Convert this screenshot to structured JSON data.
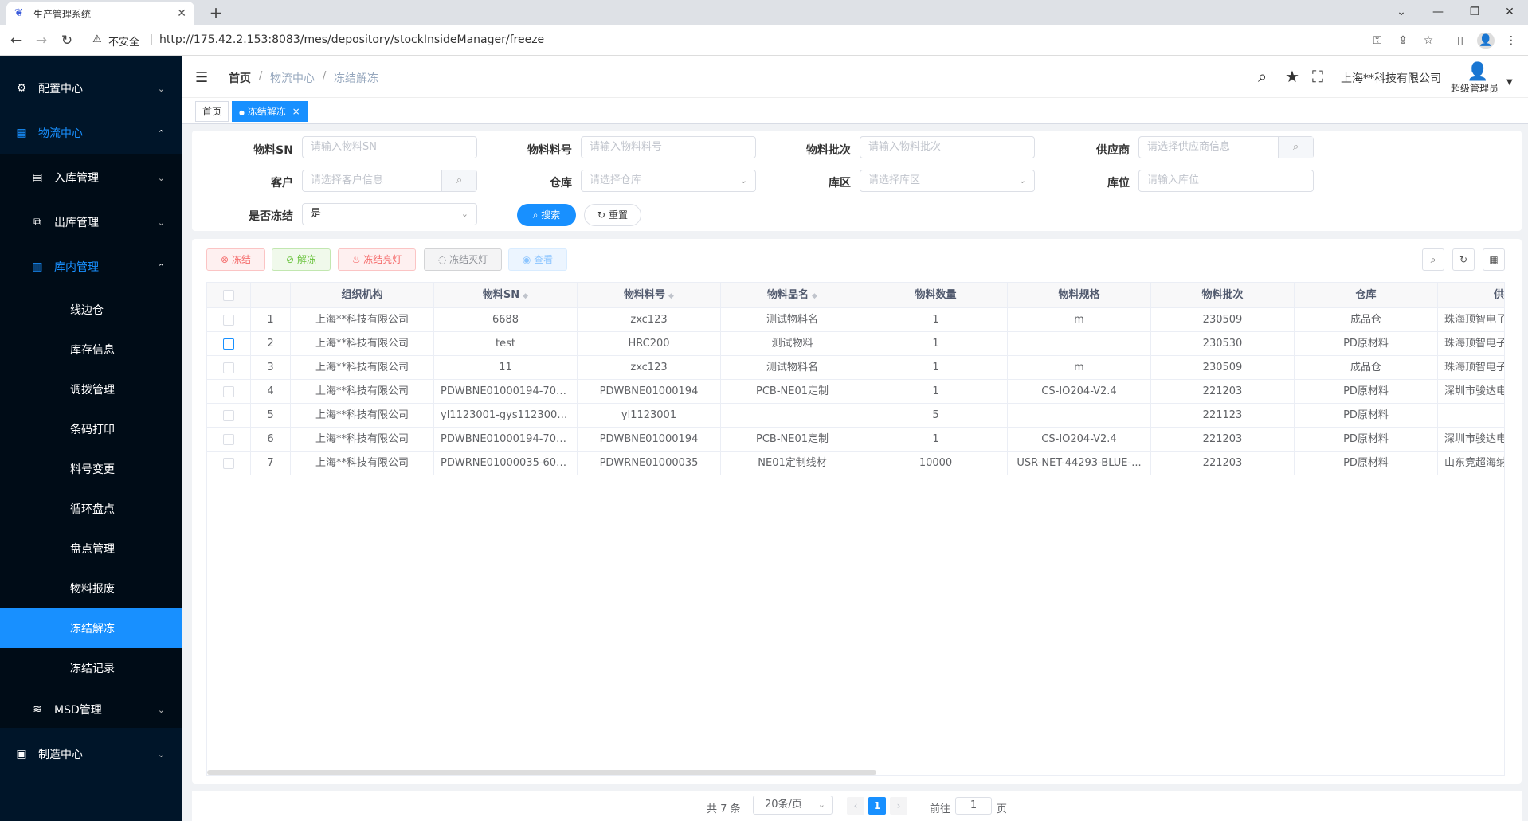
{
  "browser": {
    "tab_title": "生产管理系统",
    "security_label": "不安全",
    "url": "http://175.42.2.153:8083/mes/depository/stockInsideManager/freeze"
  },
  "sidebar": {
    "items": [
      {
        "label": "配置中心",
        "icon": "gear-icon"
      },
      {
        "label": "物流中心",
        "icon": "grid-icon"
      },
      {
        "label": "入库管理",
        "icon": "inbox-icon"
      },
      {
        "label": "出库管理",
        "icon": "export-icon"
      },
      {
        "label": "库内管理",
        "icon": "warehouse-icon"
      },
      {
        "label": "线边仓"
      },
      {
        "label": "库存信息"
      },
      {
        "label": "调拨管理"
      },
      {
        "label": "条码打印"
      },
      {
        "label": "料号变更"
      },
      {
        "label": "循环盘点"
      },
      {
        "label": "盘点管理"
      },
      {
        "label": "物料报废"
      },
      {
        "label": "冻结解冻"
      },
      {
        "label": "冻结记录"
      },
      {
        "label": "MSD管理",
        "icon": "layers-icon"
      },
      {
        "label": "制造中心",
        "icon": "factory-icon"
      }
    ]
  },
  "header": {
    "breadcrumb": [
      "首页",
      "物流中心",
      "冻结解冻"
    ],
    "company": "上海**科技有限公司",
    "user": "超级管理员"
  },
  "tags": {
    "home": "首页",
    "current": "冻结解冻",
    "close": "×"
  },
  "search": {
    "sn_label": "物料SN",
    "sn_placeholder": "请输入物料SN",
    "pn_label": "物料料号",
    "pn_placeholder": "请输入物料料号",
    "batch_label": "物料批次",
    "batch_placeholder": "请输入物料批次",
    "supplier_label": "供应商",
    "supplier_placeholder": "请选择供应商信息",
    "customer_label": "客户",
    "customer_placeholder": "请选择客户信息",
    "warehouse_label": "仓库",
    "warehouse_placeholder": "请选择仓库",
    "area_label": "库区",
    "area_placeholder": "请选择库区",
    "location_label": "库位",
    "location_placeholder": "请输入库位",
    "frozen_label": "是否冻结",
    "frozen_value": "是",
    "search_btn": "搜索",
    "reset_btn": "重置"
  },
  "toolbar": {
    "freeze": "冻结",
    "unfreeze": "解冻",
    "freeze_light_on": "冻结亮灯",
    "freeze_light_off": "冻结灭灯",
    "view": "查看"
  },
  "table": {
    "columns": [
      "组织机构",
      "物料SN",
      "物料料号",
      "物料品名",
      "物料数量",
      "物料规格",
      "物料批次",
      "仓库",
      "供"
    ],
    "rows": [
      {
        "no": "1",
        "org": "上海**科技有限公司",
        "sn": "6688",
        "pn": "zxc123",
        "name": "测试物料名",
        "qty": "1",
        "spec": "m",
        "batch": "230509",
        "wh": "成品仓",
        "supplier": "珠海顶智电子"
      },
      {
        "no": "2",
        "org": "上海**科技有限公司",
        "sn": "test",
        "pn": "HRC200",
        "name": "测试物料",
        "qty": "1",
        "spec": "",
        "batch": "230530",
        "wh": "PD原材料",
        "supplier": "珠海顶智电子"
      },
      {
        "no": "3",
        "org": "上海**科技有限公司",
        "sn": "11",
        "pn": "zxc123",
        "name": "测试物料名",
        "qty": "1",
        "spec": "m",
        "batch": "230509",
        "wh": "成品仓",
        "supplier": "珠海顶智电子"
      },
      {
        "no": "4",
        "org": "上海**科技有限公司",
        "sn": "PDWBNE01000194-701...",
        "pn": "PDWBNE01000194",
        "name": "PCB-NE01定制",
        "qty": "1",
        "spec": "CS-IO204-V2.4",
        "batch": "221203",
        "wh": "PD原材料",
        "supplier": "深圳市骏达电"
      },
      {
        "no": "5",
        "org": "上海**科技有限公司",
        "sn": "yl1123001-gys1123001...",
        "pn": "yl1123001",
        "name": "",
        "qty": "5",
        "spec": "",
        "batch": "221123",
        "wh": "PD原材料",
        "supplier": ""
      },
      {
        "no": "6",
        "org": "上海**科技有限公司",
        "sn": "PDWBNE01000194-701...",
        "pn": "PDWBNE01000194",
        "name": "PCB-NE01定制",
        "qty": "1",
        "spec": "CS-IO204-V2.4",
        "batch": "221203",
        "wh": "PD原材料",
        "supplier": "深圳市骏达电"
      },
      {
        "no": "7",
        "org": "上海**科技有限公司",
        "sn": "PDWRNE01000035-601...",
        "pn": "PDWRNE01000035",
        "name": "NE01定制线材",
        "qty": "10000",
        "spec": "USR-NET-44293-BLUE-...",
        "batch": "221203",
        "wh": "PD原材料",
        "supplier": "山东竞超海纳"
      }
    ]
  },
  "pager": {
    "total": "共 7 条",
    "page_size": "20条/页",
    "current": "1",
    "goto_prefix": "前往",
    "goto_value": "1",
    "goto_suffix": "页"
  }
}
